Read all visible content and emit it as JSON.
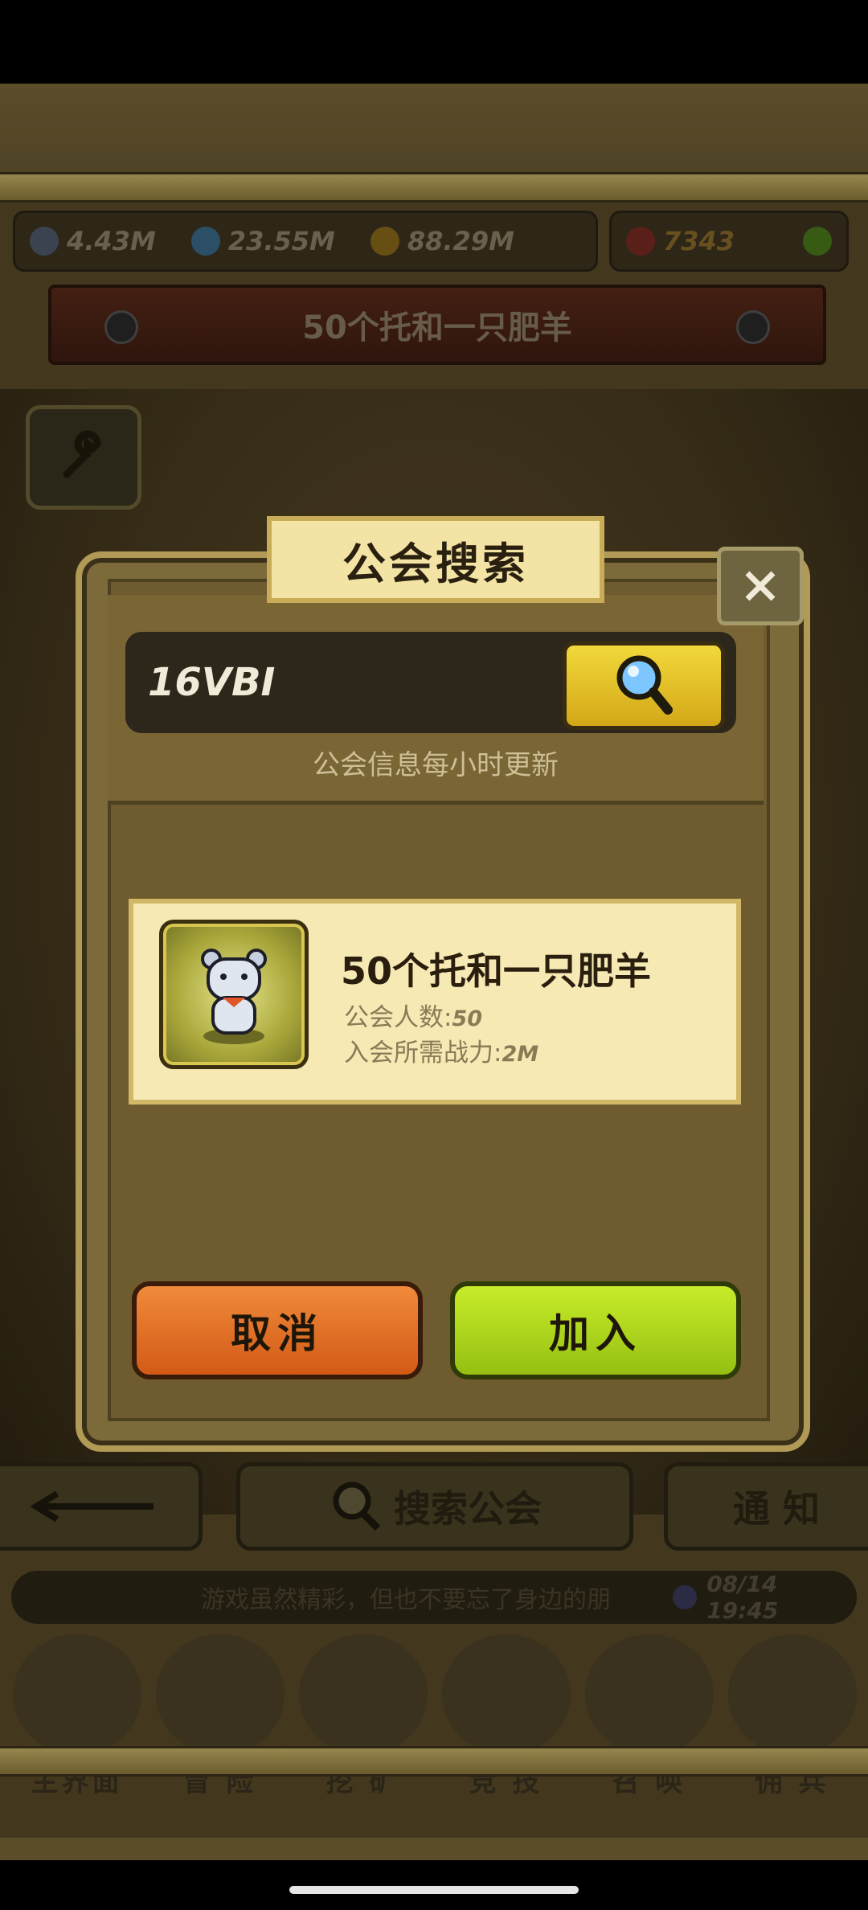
{
  "resources": [
    {
      "icon": "sword-icon",
      "value": "4.43M"
    },
    {
      "icon": "exp-icon",
      "value": "23.55M"
    },
    {
      "icon": "coin-icon",
      "value": "88.29M"
    },
    {
      "icon": "gem-icon",
      "value": "7343"
    }
  ],
  "guild_banner": "50个托和一只肥羊",
  "bottom_buttons": {
    "search": "搜索公会",
    "notice": "通 知"
  },
  "ticker": {
    "text": "游戏虽然精彩，但也不要忘了身边的朋",
    "time": "08/14 19:45"
  },
  "nav": [
    "主界面",
    "冒 险",
    "挖 矿",
    "竞 技",
    "召 唤",
    "佣 兵"
  ],
  "dialog": {
    "title": "公会搜索",
    "search_value": "16VBI",
    "hint": "公会信息每小时更新",
    "result": {
      "name": "50个托和一只肥羊",
      "members_label": "公会人数:",
      "members_value": "50",
      "power_label": "入会所需战力:",
      "power_value": "2M"
    },
    "cancel_label": "取消",
    "join_label": "加入"
  },
  "colors": {
    "cancel": "#e06a22",
    "join": "#b6dc1e",
    "search_btn": "#e8c428",
    "card": "#f6e9b4"
  }
}
